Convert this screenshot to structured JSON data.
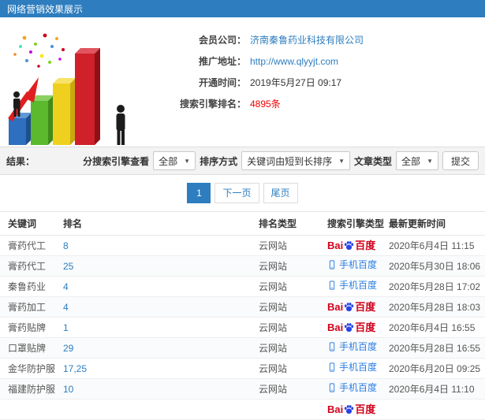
{
  "header": {
    "title": "网络营销效果展示"
  },
  "info": {
    "company_label": "会员公司：",
    "company_value": "济南秦鲁药业科技有限公司",
    "url_label": "推广地址：",
    "url_value": "http://www.qlyyjt.com",
    "open_label": "开通时间：",
    "open_value": "2019年5月27日 09:17",
    "rank_label": "搜索引擎排名：",
    "rank_value": "4895条"
  },
  "filters": {
    "result_label": "结果：",
    "engine_label": "分搜索引擎查看",
    "engine_value": "全部",
    "sort_label": "排序方式",
    "sort_value": "关键词由短到长排序",
    "article_label": "文章类型",
    "article_value": "全部",
    "submit_label": "提交",
    "caret": "▼"
  },
  "pagination": {
    "current": "1",
    "next_label": "下一页",
    "last_label": "尾页"
  },
  "table": {
    "headers": [
      "关键词",
      "排名",
      "排名类型",
      "搜索引擎类型",
      "最新更新时间"
    ],
    "rows": [
      {
        "keyword": "膏药代工",
        "rank": "8",
        "rank_type": "云网站",
        "engine": "baidu",
        "time": "2020年6月4日 11:15"
      },
      {
        "keyword": "膏药代工",
        "rank": "25",
        "rank_type": "云网站",
        "engine": "mobile",
        "time": "2020年5月30日 18:06"
      },
      {
        "keyword": "秦鲁药业",
        "rank": "4",
        "rank_type": "云网站",
        "engine": "mobile",
        "time": "2020年5月28日 17:02"
      },
      {
        "keyword": "膏药加工",
        "rank": "4",
        "rank_type": "云网站",
        "engine": "baidu",
        "time": "2020年5月28日 18:03"
      },
      {
        "keyword": "膏药贴牌",
        "rank": "1",
        "rank_type": "云网站",
        "engine": "baidu",
        "time": "2020年6月4日 16:55"
      },
      {
        "keyword": "口罩贴牌",
        "rank": "29",
        "rank_type": "云网站",
        "engine": "mobile",
        "time": "2020年5月28日 16:55"
      },
      {
        "keyword": "金华防护服",
        "rank": "17,25",
        "rank_type": "云网站",
        "engine": "mobile",
        "time": "2020年6月20日 09:25"
      },
      {
        "keyword": "福建防护服",
        "rank": "10",
        "rank_type": "云网站",
        "engine": "mobile",
        "time": "2020年6月4日 11:10"
      },
      {
        "keyword": "",
        "rank": "",
        "rank_type": "",
        "engine": "baidu",
        "time": ""
      }
    ]
  },
  "engines": {
    "baidu": {
      "latin": "Bai",
      "cn": "百度"
    },
    "mobile": {
      "label": "手机百度"
    }
  },
  "colors": {
    "titlebar_blue": "#2d7dbf",
    "link_blue": "#2d7dbf",
    "highlight_red": "#f20000",
    "baidu_red": "#d0021b",
    "baidu_paw_blue": "#2743e8",
    "mobile_baidu_blue": "#2a7de1"
  }
}
